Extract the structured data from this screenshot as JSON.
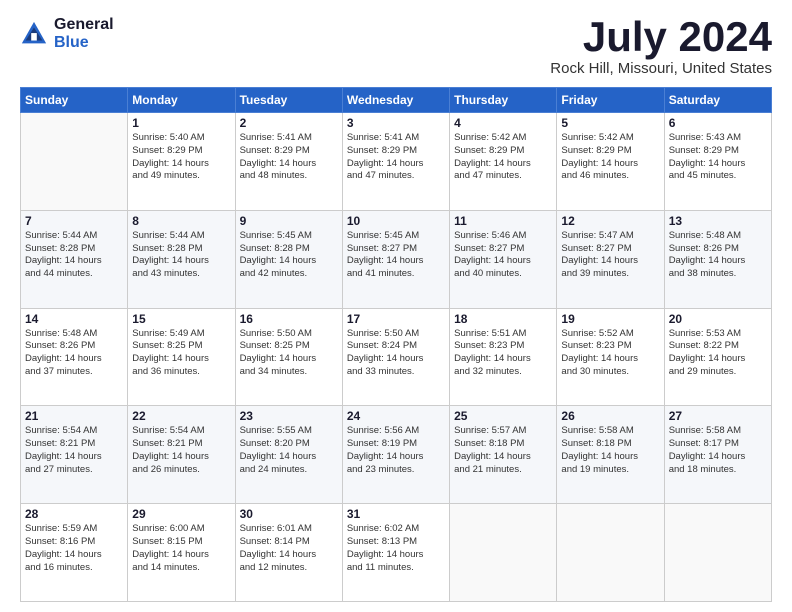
{
  "header": {
    "logo_general": "General",
    "logo_blue": "Blue",
    "month_title": "July 2024",
    "location": "Rock Hill, Missouri, United States"
  },
  "days_of_week": [
    "Sunday",
    "Monday",
    "Tuesday",
    "Wednesday",
    "Thursday",
    "Friday",
    "Saturday"
  ],
  "weeks": [
    [
      {
        "day": "",
        "content": ""
      },
      {
        "day": "1",
        "content": "Sunrise: 5:40 AM\nSunset: 8:29 PM\nDaylight: 14 hours\nand 49 minutes."
      },
      {
        "day": "2",
        "content": "Sunrise: 5:41 AM\nSunset: 8:29 PM\nDaylight: 14 hours\nand 48 minutes."
      },
      {
        "day": "3",
        "content": "Sunrise: 5:41 AM\nSunset: 8:29 PM\nDaylight: 14 hours\nand 47 minutes."
      },
      {
        "day": "4",
        "content": "Sunrise: 5:42 AM\nSunset: 8:29 PM\nDaylight: 14 hours\nand 47 minutes."
      },
      {
        "day": "5",
        "content": "Sunrise: 5:42 AM\nSunset: 8:29 PM\nDaylight: 14 hours\nand 46 minutes."
      },
      {
        "day": "6",
        "content": "Sunrise: 5:43 AM\nSunset: 8:29 PM\nDaylight: 14 hours\nand 45 minutes."
      }
    ],
    [
      {
        "day": "7",
        "content": "Sunrise: 5:44 AM\nSunset: 8:28 PM\nDaylight: 14 hours\nand 44 minutes."
      },
      {
        "day": "8",
        "content": "Sunrise: 5:44 AM\nSunset: 8:28 PM\nDaylight: 14 hours\nand 43 minutes."
      },
      {
        "day": "9",
        "content": "Sunrise: 5:45 AM\nSunset: 8:28 PM\nDaylight: 14 hours\nand 42 minutes."
      },
      {
        "day": "10",
        "content": "Sunrise: 5:45 AM\nSunset: 8:27 PM\nDaylight: 14 hours\nand 41 minutes."
      },
      {
        "day": "11",
        "content": "Sunrise: 5:46 AM\nSunset: 8:27 PM\nDaylight: 14 hours\nand 40 minutes."
      },
      {
        "day": "12",
        "content": "Sunrise: 5:47 AM\nSunset: 8:27 PM\nDaylight: 14 hours\nand 39 minutes."
      },
      {
        "day": "13",
        "content": "Sunrise: 5:48 AM\nSunset: 8:26 PM\nDaylight: 14 hours\nand 38 minutes."
      }
    ],
    [
      {
        "day": "14",
        "content": "Sunrise: 5:48 AM\nSunset: 8:26 PM\nDaylight: 14 hours\nand 37 minutes."
      },
      {
        "day": "15",
        "content": "Sunrise: 5:49 AM\nSunset: 8:25 PM\nDaylight: 14 hours\nand 36 minutes."
      },
      {
        "day": "16",
        "content": "Sunrise: 5:50 AM\nSunset: 8:25 PM\nDaylight: 14 hours\nand 34 minutes."
      },
      {
        "day": "17",
        "content": "Sunrise: 5:50 AM\nSunset: 8:24 PM\nDaylight: 14 hours\nand 33 minutes."
      },
      {
        "day": "18",
        "content": "Sunrise: 5:51 AM\nSunset: 8:23 PM\nDaylight: 14 hours\nand 32 minutes."
      },
      {
        "day": "19",
        "content": "Sunrise: 5:52 AM\nSunset: 8:23 PM\nDaylight: 14 hours\nand 30 minutes."
      },
      {
        "day": "20",
        "content": "Sunrise: 5:53 AM\nSunset: 8:22 PM\nDaylight: 14 hours\nand 29 minutes."
      }
    ],
    [
      {
        "day": "21",
        "content": "Sunrise: 5:54 AM\nSunset: 8:21 PM\nDaylight: 14 hours\nand 27 minutes."
      },
      {
        "day": "22",
        "content": "Sunrise: 5:54 AM\nSunset: 8:21 PM\nDaylight: 14 hours\nand 26 minutes."
      },
      {
        "day": "23",
        "content": "Sunrise: 5:55 AM\nSunset: 8:20 PM\nDaylight: 14 hours\nand 24 minutes."
      },
      {
        "day": "24",
        "content": "Sunrise: 5:56 AM\nSunset: 8:19 PM\nDaylight: 14 hours\nand 23 minutes."
      },
      {
        "day": "25",
        "content": "Sunrise: 5:57 AM\nSunset: 8:18 PM\nDaylight: 14 hours\nand 21 minutes."
      },
      {
        "day": "26",
        "content": "Sunrise: 5:58 AM\nSunset: 8:18 PM\nDaylight: 14 hours\nand 19 minutes."
      },
      {
        "day": "27",
        "content": "Sunrise: 5:58 AM\nSunset: 8:17 PM\nDaylight: 14 hours\nand 18 minutes."
      }
    ],
    [
      {
        "day": "28",
        "content": "Sunrise: 5:59 AM\nSunset: 8:16 PM\nDaylight: 14 hours\nand 16 minutes."
      },
      {
        "day": "29",
        "content": "Sunrise: 6:00 AM\nSunset: 8:15 PM\nDaylight: 14 hours\nand 14 minutes."
      },
      {
        "day": "30",
        "content": "Sunrise: 6:01 AM\nSunset: 8:14 PM\nDaylight: 14 hours\nand 12 minutes."
      },
      {
        "day": "31",
        "content": "Sunrise: 6:02 AM\nSunset: 8:13 PM\nDaylight: 14 hours\nand 11 minutes."
      },
      {
        "day": "",
        "content": ""
      },
      {
        "day": "",
        "content": ""
      },
      {
        "day": "",
        "content": ""
      }
    ]
  ]
}
